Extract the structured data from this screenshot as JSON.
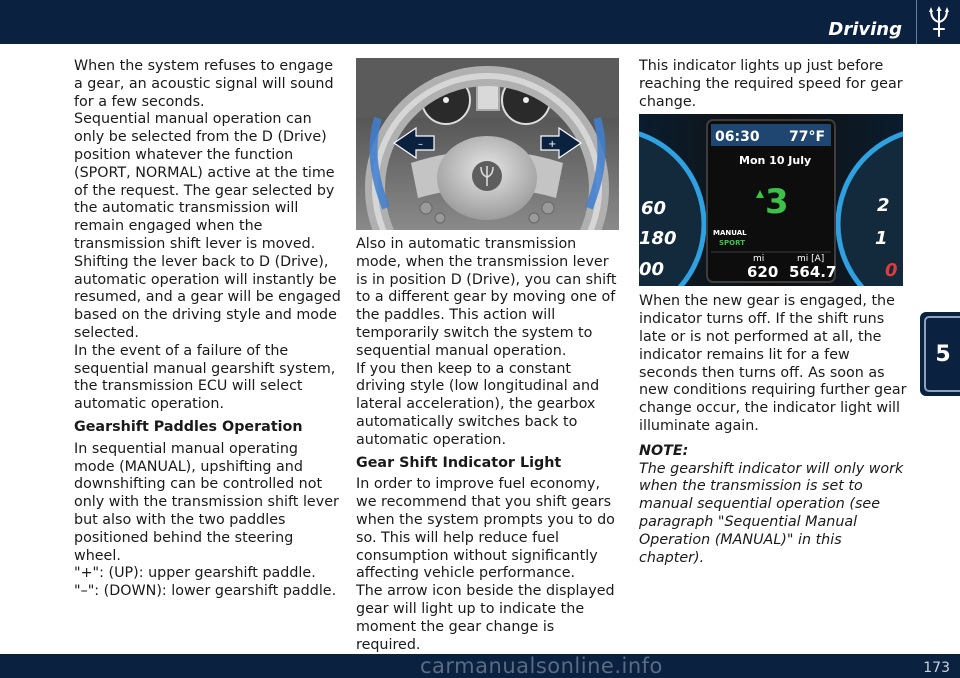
{
  "header": {
    "section_title": "Driving"
  },
  "chapter_tab": {
    "number": "5"
  },
  "footer": {
    "page_number": "173",
    "watermark": "carmanualsonline.info"
  },
  "column1": {
    "paragraphs": [
      "When the system refuses to engage a gear, an acoustic signal will sound for a few seconds.",
      "Sequential manual operation can only be selected from the D (Drive) position whatever the function (SPORT, NORMAL) active at the time of the request. The gear selected by the automatic transmission will remain engaged when the transmission shift lever is moved.",
      "Shifting the lever back to D (Drive), automatic operation will instantly be resumed, and a gear will be engaged based on the driving style and mode selected.",
      "In the event of a failure of the sequential manual gearshift system, the transmission ECU will select automatic operation."
    ],
    "subheading": "Gearshift Paddles Operation",
    "paragraphs2": [
      "In sequential manual operating mode (MANUAL), upshifting and downshifting can be controlled not only with the transmission shift lever but also with the two paddles positioned behind the steering wheel.",
      "\"+\": (UP): upper gearshift paddle.",
      "\"–\": (DOWN): lower gearshift paddle."
    ]
  },
  "column2": {
    "figure": {
      "plus_label": "+",
      "minus_label": "–"
    },
    "paragraphs": [
      "Also in automatic transmission mode, when the transmission lever is in position D (Drive), you can shift to a different gear by moving one of the paddles. This action will temporarily switch the system to sequential manual operation.",
      "If you then keep to a constant driving style (low longitudinal and lateral acceleration), the gearbox automatically switches back to automatic operation."
    ],
    "subheading": "Gear Shift Indicator Light",
    "paragraphs2": [
      "In order to improve fuel economy, we recommend that you shift gears when the system prompts you to do so. This will help reduce fuel consumption without significantly affecting vehicle performance.",
      "The arrow icon beside the displayed gear will light up to indicate the moment the gear change is required."
    ]
  },
  "column3": {
    "intro": "This indicator lights up just before reaching the required speed for gear change.",
    "cluster": {
      "time": "06:30",
      "temperature": "77°F",
      "date": "Mon 10 July",
      "gear": "3",
      "mode_manual": "MANUAL",
      "mode_sport": "SPORT",
      "odo_unit": "mi",
      "odo_value": "620",
      "trip_unit": "mi [A]",
      "trip_value": "564.7",
      "left_gauge_labels": [
        "60",
        "180",
        "00"
      ],
      "right_gauge_labels": [
        "2",
        "1",
        "0"
      ]
    },
    "paragraph": "When the new gear is engaged, the indicator turns off. If the shift runs late or is not performed at all, the indicator remains lit for a few seconds then turns off. As soon as new conditions requiring further gear change occur, the indicator light will illuminate again.",
    "note_label": "NOTE:",
    "note_text": "The gearshift indicator will only work when the transmission is set to manual sequential operation (see paragraph \"Sequential Manual Operation (MANUAL)\" in this chapter)."
  },
  "colors": {
    "navy": "#0b2140",
    "cluster_accent": "#2fa0e0",
    "gear_green": "#3cc24a"
  }
}
